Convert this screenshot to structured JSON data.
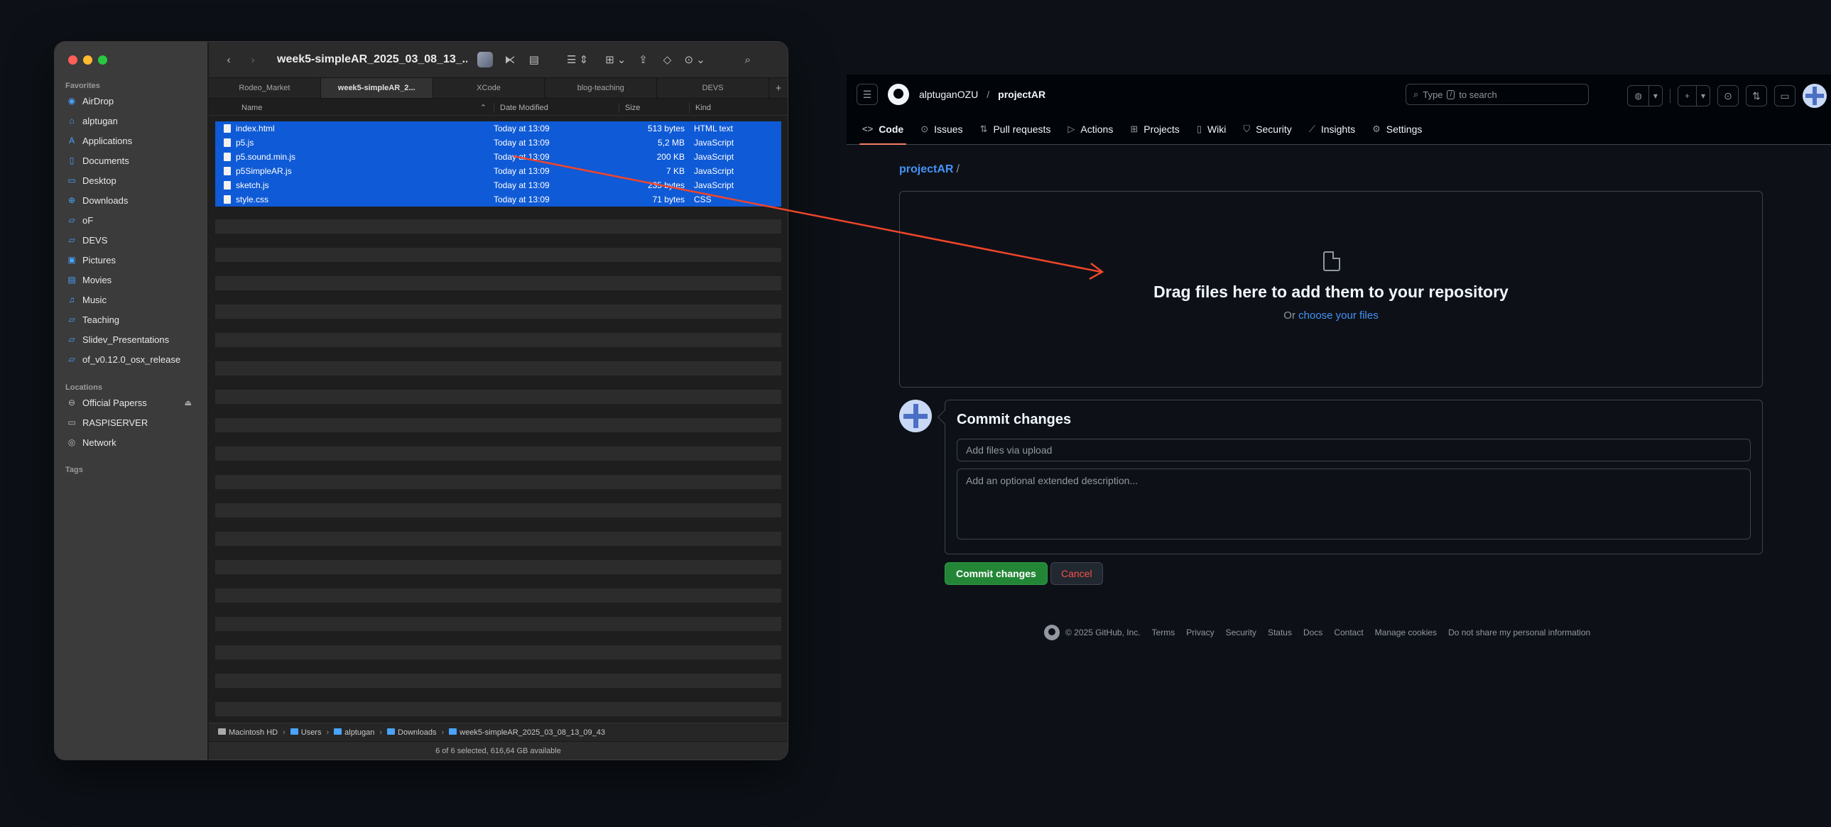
{
  "finder": {
    "title": "week5-simpleAR_2025_03_08_13_...",
    "tabs": [
      "Rodeo_Market",
      "week5-simpleAR_2...",
      "XCode",
      "blog-teaching",
      "DEVS"
    ],
    "active_tab": 1,
    "favorites_label": "Favorites",
    "favorites": [
      {
        "label": "AirDrop",
        "icon": "airdrop-icon"
      },
      {
        "label": "alptugan",
        "icon": "home-icon"
      },
      {
        "label": "Applications",
        "icon": "applications-icon"
      },
      {
        "label": "Documents",
        "icon": "document-icon"
      },
      {
        "label": "Desktop",
        "icon": "desktop-icon"
      },
      {
        "label": "Downloads",
        "icon": "download-icon"
      },
      {
        "label": "oF",
        "icon": "folder-icon"
      },
      {
        "label": "DEVS",
        "icon": "folder-icon"
      },
      {
        "label": "Pictures",
        "icon": "pictures-icon"
      },
      {
        "label": "Movies",
        "icon": "movies-icon"
      },
      {
        "label": "Music",
        "icon": "music-icon"
      },
      {
        "label": "Teaching",
        "icon": "folder-icon"
      },
      {
        "label": "Slidev_Presentations",
        "icon": "folder-icon"
      },
      {
        "label": "of_v0.12.0_osx_release",
        "icon": "folder-icon"
      }
    ],
    "locations_label": "Locations",
    "locations": [
      {
        "label": "Official Paperss",
        "icon": "drive-icon"
      },
      {
        "label": "RASPISERVER",
        "icon": "server-icon"
      },
      {
        "label": "Network",
        "icon": "network-icon"
      }
    ],
    "tags_label": "Tags",
    "columns": {
      "name": "Name",
      "date": "Date Modified",
      "size": "Size",
      "kind": "Kind"
    },
    "files": [
      {
        "name": "index.html",
        "date": "Today at 13:09",
        "size": "513 bytes",
        "kind": "HTML text"
      },
      {
        "name": "p5.js",
        "date": "Today at 13:09",
        "size": "5,2 MB",
        "kind": "JavaScript"
      },
      {
        "name": "p5.sound.min.js",
        "date": "Today at 13:09",
        "size": "200 KB",
        "kind": "JavaScript"
      },
      {
        "name": "p5SimpleAR.js",
        "date": "Today at 13:09",
        "size": "7 KB",
        "kind": "JavaScript"
      },
      {
        "name": "sketch.js",
        "date": "Today at 13:09",
        "size": "235 bytes",
        "kind": "JavaScript"
      },
      {
        "name": "style.css",
        "date": "Today at 13:09",
        "size": "71 bytes",
        "kind": "CSS"
      }
    ],
    "path": [
      "Macintosh HD",
      "Users",
      "alptugan",
      "Downloads",
      "week5-simpleAR_2025_03_08_13_09_43"
    ],
    "status": "6 of 6 selected, 616,64 GB available"
  },
  "github": {
    "owner": "alptuganOZU",
    "repo": "projectAR",
    "search": {
      "pre": "Type",
      "key": "/",
      "post": "to search"
    },
    "nav": [
      {
        "label": "Code",
        "icon": "code-icon"
      },
      {
        "label": "Issues",
        "icon": "issue-icon"
      },
      {
        "label": "Pull requests",
        "icon": "pull-request-icon"
      },
      {
        "label": "Actions",
        "icon": "play-icon"
      },
      {
        "label": "Projects",
        "icon": "table-icon"
      },
      {
        "label": "Wiki",
        "icon": "book-icon"
      },
      {
        "label": "Security",
        "icon": "shield-icon"
      },
      {
        "label": "Insights",
        "icon": "graph-icon"
      },
      {
        "label": "Settings",
        "icon": "gear-icon"
      }
    ],
    "breadcrumb": {
      "repo": "projectAR",
      "sep": "/"
    },
    "dropzone": {
      "title": "Drag files here to add them to your repository",
      "or": "Or",
      "link": "choose your files"
    },
    "commit": {
      "title": "Commit changes",
      "summary_placeholder": "Add files via upload",
      "description_placeholder": "Add an optional extended description...",
      "commit_button": "Commit changes",
      "cancel_button": "Cancel"
    },
    "footer": [
      "© 2025 GitHub, Inc.",
      "Terms",
      "Privacy",
      "Security",
      "Status",
      "Docs",
      "Contact",
      "Manage cookies",
      "Do not share my personal information"
    ]
  },
  "colors": {
    "selection": "#0f5ad6",
    "link": "#4493f8",
    "commit_green": "#238636",
    "arrow": "#f0452b"
  }
}
